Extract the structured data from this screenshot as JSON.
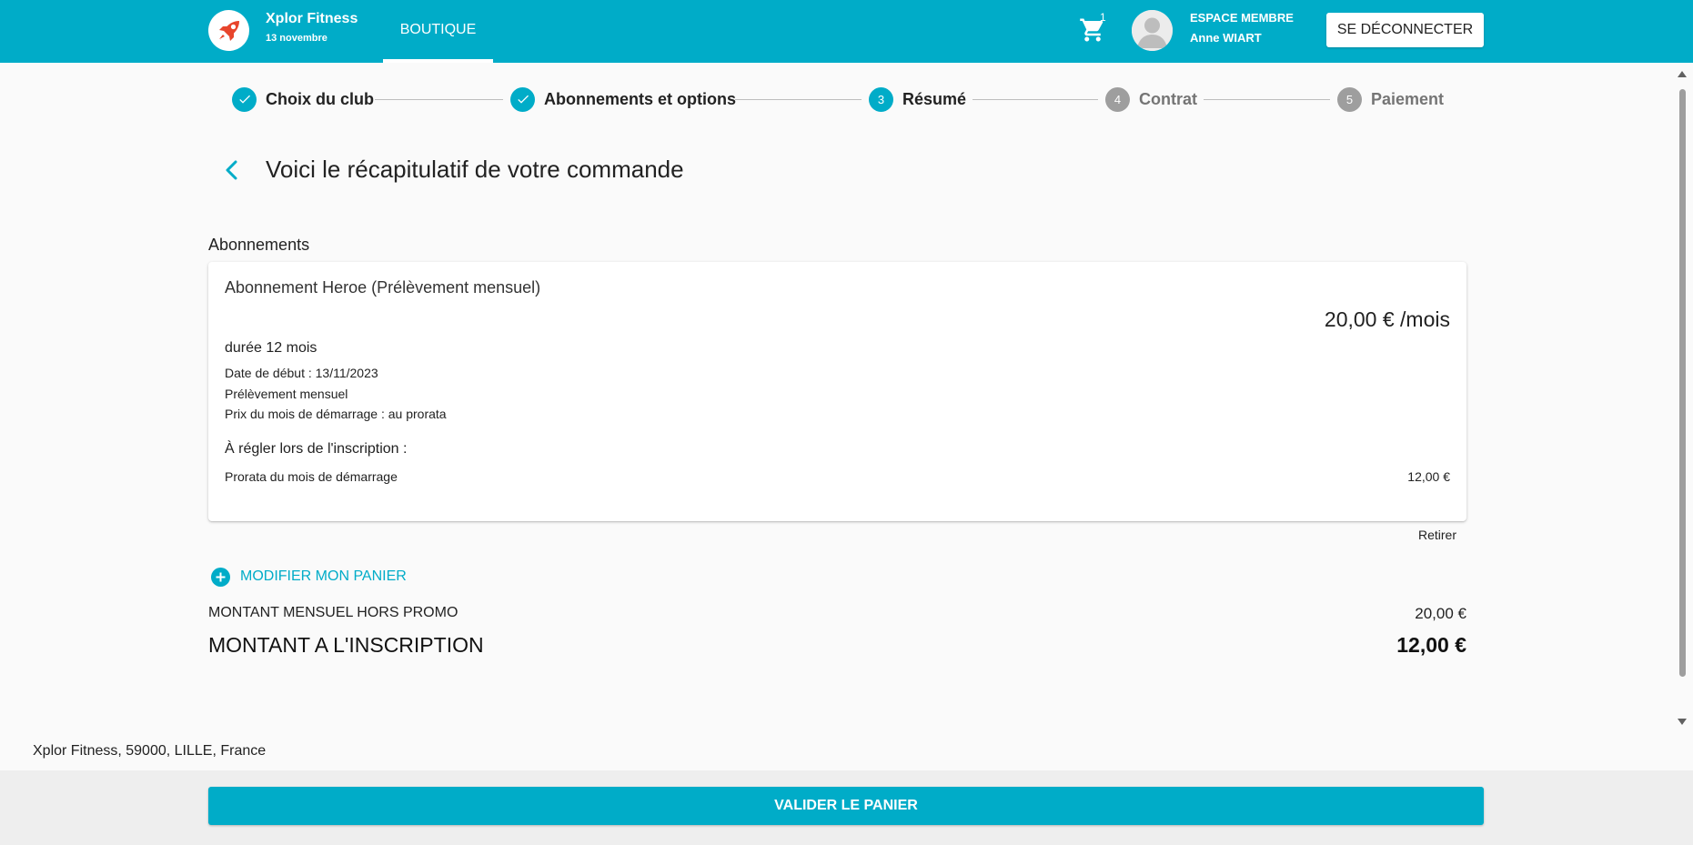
{
  "header": {
    "brand_name": "Xplor Fitness",
    "brand_date": "13 novembre",
    "nav_tab": "BOUTIQUE",
    "cart_count": "1",
    "member_label": "ESPACE MEMBRE",
    "member_name": "Anne WIART",
    "logout_label": "SE DÉCONNECTER"
  },
  "stepper": {
    "steps": [
      {
        "number": "1",
        "label": "Choix du club",
        "state": "done"
      },
      {
        "number": "2",
        "label": "Abonnements et options",
        "state": "done"
      },
      {
        "number": "3",
        "label": "Résumé",
        "state": "active"
      },
      {
        "number": "4",
        "label": "Contrat",
        "state": "todo"
      },
      {
        "number": "5",
        "label": "Paiement",
        "state": "todo"
      }
    ]
  },
  "page": {
    "title": "Voici le récapitulatif de votre commande",
    "section_label": "Abonnements"
  },
  "subscription": {
    "name": "Abonnement Heroe (Prélèvement mensuel)",
    "price": "20,00 € /mois",
    "duration": "durée 12 mois",
    "start_date": "Date de début : 13/11/2023",
    "payment_mode": "Prélèvement mensuel",
    "start_month_price": "Prix du mois de démarrage : au prorata",
    "due_at_signup_label": "À régler lors de l'inscription :",
    "prorata_label": "Prorata du mois de démarrage",
    "prorata_value": "12,00 €",
    "remove_label": "Retirer"
  },
  "cart": {
    "modify_label": "MODIFIER MON PANIER",
    "monthly_label": "MONTANT MENSUEL HORS PROMO",
    "monthly_value": "20,00 €",
    "total_label": "MONTANT A L'INSCRIPTION",
    "total_value": "12,00 €"
  },
  "footer": {
    "address": "Xplor Fitness, 59000, LILLE, France",
    "validate_label": "VALIDER LE PANIER"
  },
  "colors": {
    "accent": "#00acc8",
    "logo_red": "#e8452c",
    "inactive_step": "#9e9e9e"
  },
  "icons": {
    "logo": "rocket-icon",
    "cart": "cart-icon",
    "avatar": "user-icon",
    "back": "chevron-left-icon",
    "step_done": "check-icon",
    "modify": "plus-circle-icon"
  }
}
